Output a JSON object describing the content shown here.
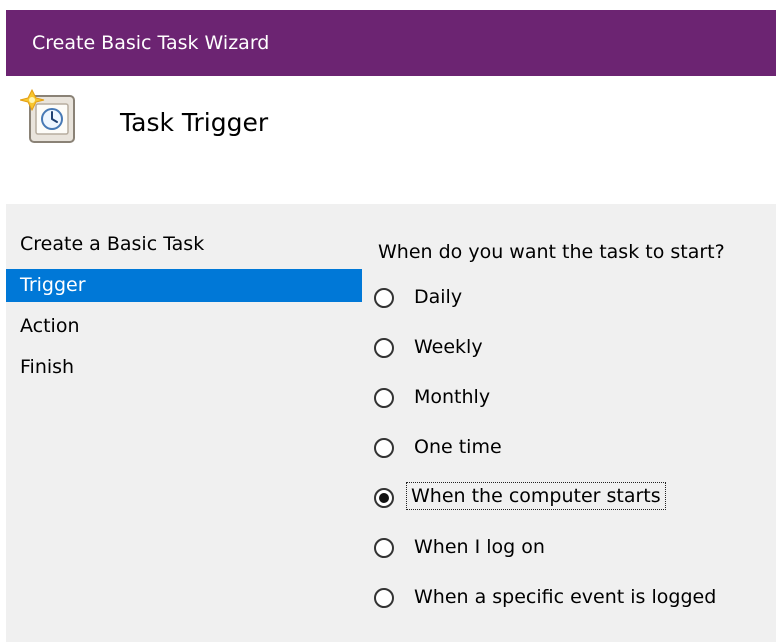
{
  "window": {
    "title": "Create Basic Task Wizard"
  },
  "header": {
    "title": "Task Trigger",
    "icon": "scheduled-task-icon"
  },
  "steps": [
    {
      "label": "Create a Basic Task",
      "selected": false
    },
    {
      "label": "Trigger",
      "selected": true
    },
    {
      "label": "Action",
      "selected": false
    },
    {
      "label": "Finish",
      "selected": false
    }
  ],
  "trigger": {
    "question": "When do you want the task to start?",
    "options": [
      {
        "label": "Daily",
        "mnemonic": "D",
        "checked": false
      },
      {
        "label": "Weekly",
        "mnemonic": "W",
        "checked": false
      },
      {
        "label": "Monthly",
        "mnemonic": "M",
        "checked": false
      },
      {
        "label": "One time",
        "mnemonic": "O",
        "checked": false
      },
      {
        "label": "When the computer starts",
        "mnemonic": "h",
        "checked": true
      },
      {
        "label": "When I log on",
        "mnemonic": "l",
        "checked": false
      },
      {
        "label": "When a specific event is logged",
        "mnemonic": "e",
        "checked": false
      }
    ]
  },
  "colors": {
    "titlebar": "#6c2472",
    "selection": "#0078d7",
    "content_background": "#f0f0f0"
  }
}
